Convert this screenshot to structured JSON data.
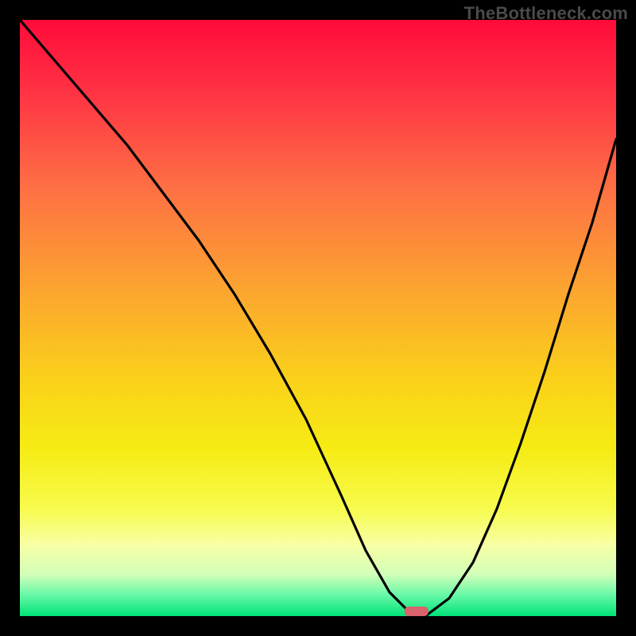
{
  "watermark": "TheBottleneck.com",
  "chart_data": {
    "type": "line",
    "title": "",
    "xlabel": "",
    "ylabel": "",
    "xlim": [
      0,
      100
    ],
    "ylim": [
      0,
      100
    ],
    "grid": false,
    "legend": false,
    "background_gradient": {
      "type": "vertical",
      "stops": [
        {
          "pos": 0.0,
          "color": "#ff0b3a"
        },
        {
          "pos": 0.12,
          "color": "#ff3244"
        },
        {
          "pos": 0.28,
          "color": "#fe6f44"
        },
        {
          "pos": 0.45,
          "color": "#fca430"
        },
        {
          "pos": 0.6,
          "color": "#fad01a"
        },
        {
          "pos": 0.72,
          "color": "#f6ec14"
        },
        {
          "pos": 0.82,
          "color": "#f7fb4d"
        },
        {
          "pos": 0.88,
          "color": "#f8ffa5"
        },
        {
          "pos": 0.93,
          "color": "#d2ffb8"
        },
        {
          "pos": 0.965,
          "color": "#66f8a7"
        },
        {
          "pos": 1.0,
          "color": "#00e277"
        }
      ]
    },
    "series": [
      {
        "name": "bottleneck-curve",
        "color": "#000000",
        "x": [
          0,
          6,
          12,
          18,
          24,
          30,
          36,
          42,
          48,
          54,
          58,
          62,
          65,
          68,
          72,
          76,
          80,
          84,
          88,
          92,
          96,
          100
        ],
        "values": [
          100,
          93,
          86,
          79,
          71,
          63,
          54,
          44,
          33,
          20,
          11,
          4,
          1,
          0,
          3,
          9,
          18,
          29,
          41,
          54,
          66,
          80
        ]
      }
    ],
    "marker": {
      "name": "optimal-marker",
      "x": 66.5,
      "y": 0,
      "width": 4,
      "height": 1.6,
      "color": "#d9626c"
    }
  }
}
